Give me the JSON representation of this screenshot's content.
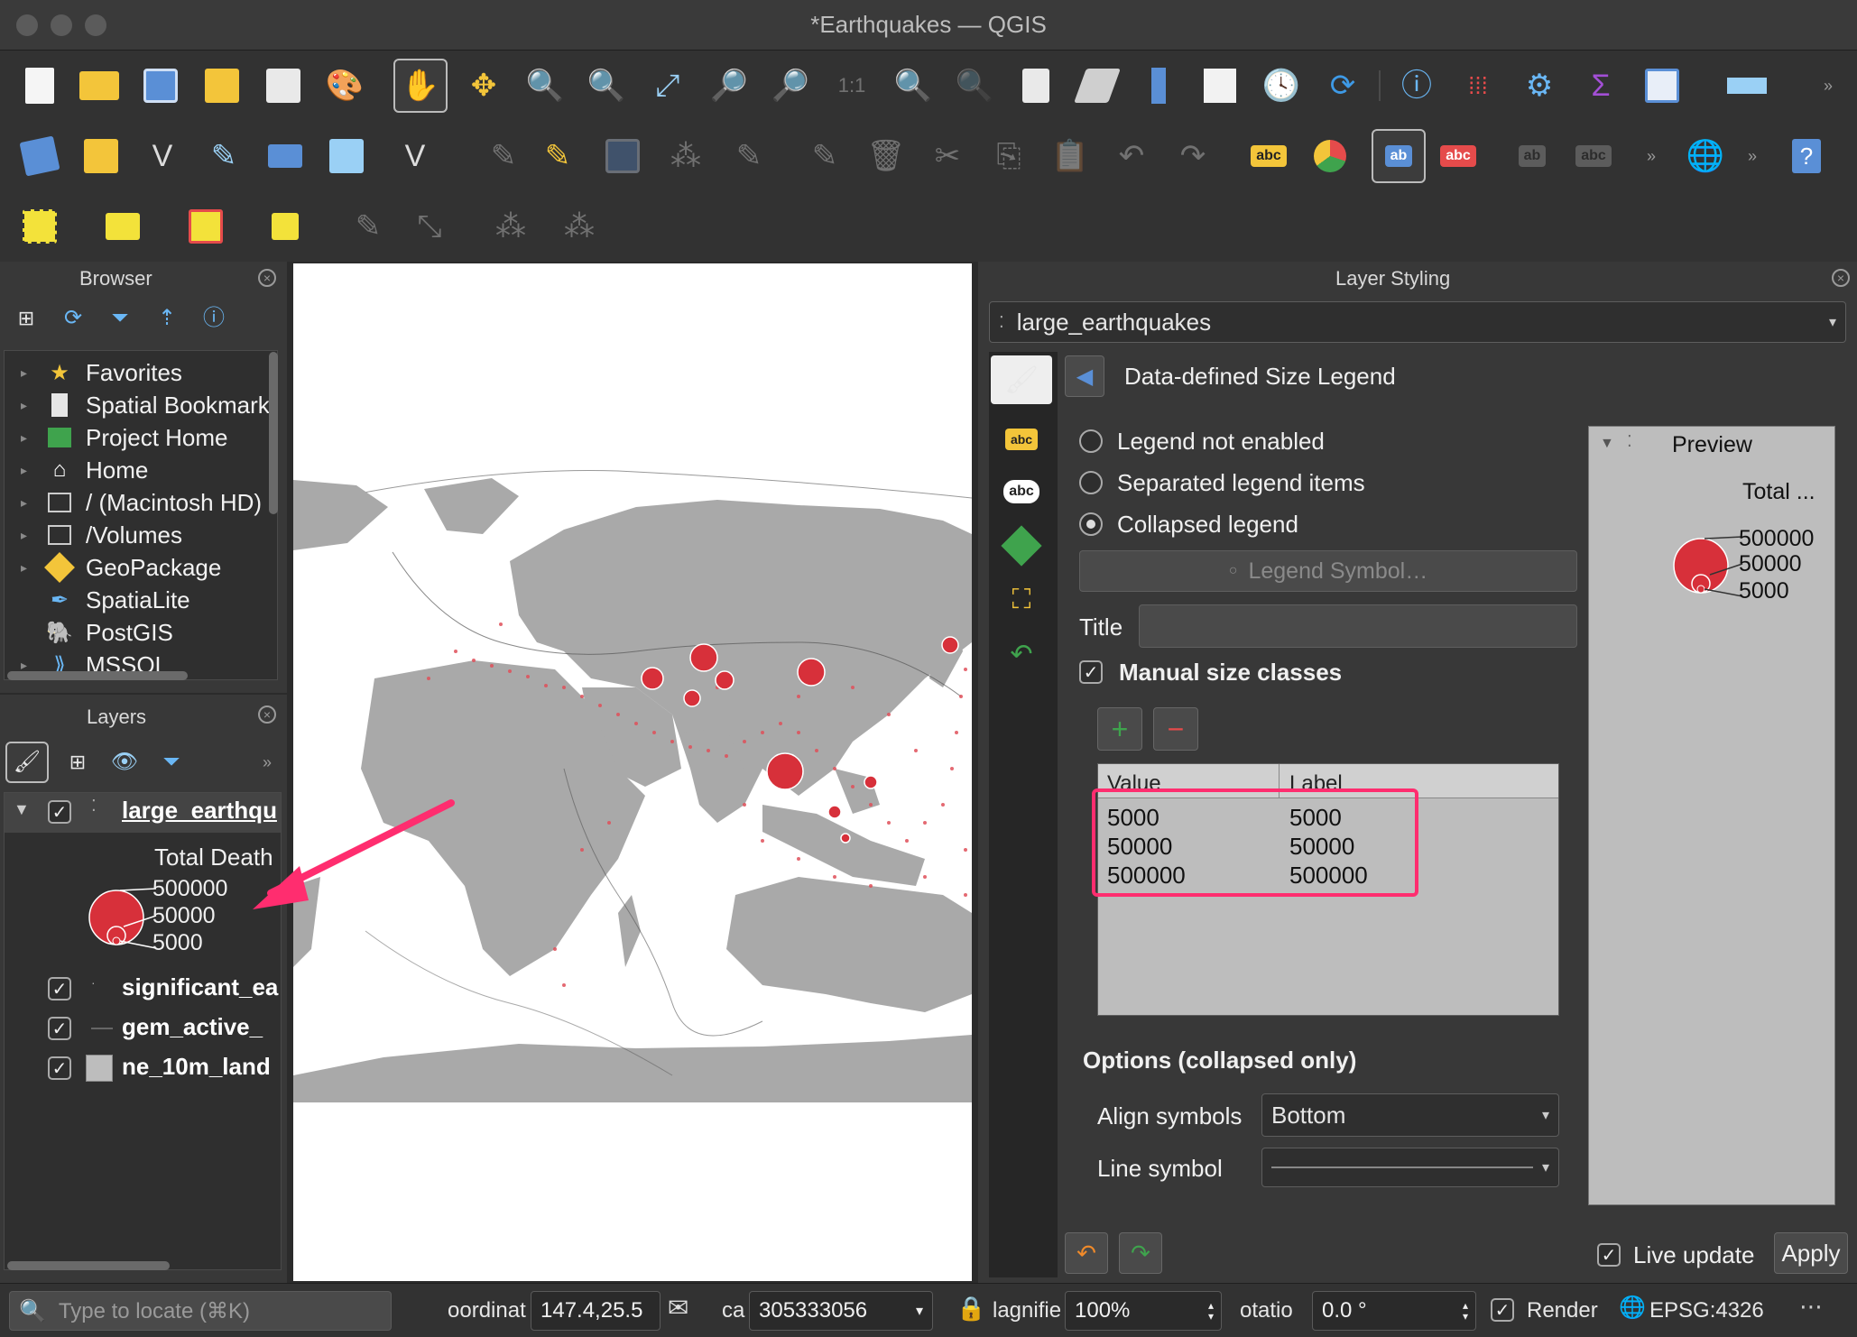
{
  "window": {
    "title": "*Earthquakes — QGIS"
  },
  "toolbar_icons": {
    "row1": [
      "new-project-icon",
      "open-project-icon",
      "save-project-icon",
      "print-layout-icon",
      "layout-manager-icon",
      "style-manager-icon",
      "pan-icon",
      "pan-to-selection-icon",
      "zoom-in-icon",
      "zoom-out-icon",
      "zoom-full-icon",
      "zoom-to-selection-icon",
      "zoom-to-layer-icon",
      "zoom-native-icon",
      "zoom-last-icon",
      "zoom-next-icon",
      "new-map-view-icon",
      "new-3d-map-view-icon",
      "new-bookmark-icon",
      "show-bookmarks-icon",
      "temporal-controller-icon",
      "refresh-icon",
      "identify-icon",
      "attribute-table-icon",
      "settings-icon",
      "statistics-icon",
      "table-icon",
      "measure-icon"
    ],
    "row2": [
      "add-layer-icon",
      "digitize-icon",
      "vertex-icon",
      "pencil-icon",
      "label-icon",
      "diagram-icon",
      "help-icon"
    ],
    "row3": [
      "select-icon",
      "deselect-icon",
      "select-all-icon",
      "new-shapefile-icon"
    ]
  },
  "browser": {
    "title": "Browser",
    "items": [
      {
        "label": "Favorites",
        "icon": "star-icon"
      },
      {
        "label": "Spatial Bookmark",
        "icon": "bookmark-icon"
      },
      {
        "label": "Project Home",
        "icon": "project-home-icon"
      },
      {
        "label": "Home",
        "icon": "home-icon"
      },
      {
        "label": "/ (Macintosh HD)",
        "icon": "folder-icon"
      },
      {
        "label": "/Volumes",
        "icon": "folder-icon"
      },
      {
        "label": "GeoPackage",
        "icon": "geopackage-icon"
      },
      {
        "label": "SpatiaLite",
        "icon": "spatialite-icon"
      },
      {
        "label": "PostGIS",
        "icon": "postgis-icon"
      },
      {
        "label": "MSSQL",
        "icon": "mssql-icon"
      }
    ]
  },
  "layers": {
    "title": "Layers",
    "items": [
      {
        "label": "large_earthqu",
        "checked": true
      },
      {
        "label": "significant_ea",
        "checked": true
      },
      {
        "label": "gem_active_",
        "checked": true
      },
      {
        "label": "ne_10m_land",
        "checked": true
      }
    ],
    "legend": {
      "title": "Total Death",
      "values": [
        "500000",
        "50000",
        "5000"
      ]
    }
  },
  "styling": {
    "title": "Layer Styling",
    "layer_name": "large_earthquakes",
    "section": "Data-defined Size Legend",
    "radio_options": [
      {
        "label": "Legend not enabled",
        "selected": false
      },
      {
        "label": "Separated legend items",
        "selected": false
      },
      {
        "label": "Collapsed legend",
        "selected": true
      }
    ],
    "legend_symbol_button": "Legend Symbol…",
    "title_label": "Title",
    "title_value": "",
    "manual_size_classes": "Manual size classes",
    "table": {
      "headers": [
        "Value",
        "Label"
      ],
      "rows": [
        [
          "5000",
          "5000"
        ],
        [
          "50000",
          "50000"
        ],
        [
          "500000",
          "500000"
        ]
      ]
    },
    "options_heading": "Options (collapsed only)",
    "align_label": "Align symbols",
    "align_value": "Bottom",
    "line_symbol_label": "Line symbol",
    "preview": {
      "title": "Preview",
      "legend_title": "Total ...",
      "values": [
        "500000",
        "50000",
        "5000"
      ]
    },
    "live_update": "Live update",
    "apply": "Apply"
  },
  "status": {
    "locator_placeholder": "Type to locate (⌘K)",
    "coord_label": "oordinat",
    "coord_value": "147.4,25.5",
    "scale_label": "ca",
    "scale_value": "305333056",
    "magnifier_label": "lagnifie",
    "magnifier_value": "100%",
    "rotation_label": "otatio",
    "rotation_value": "0.0 °",
    "render_label": "Render",
    "crs": "EPSG:4326"
  },
  "colors": {
    "accent_pink": "#ff2d6f",
    "quake_red": "#d7303a",
    "land_gray": "#a9a9a9"
  }
}
